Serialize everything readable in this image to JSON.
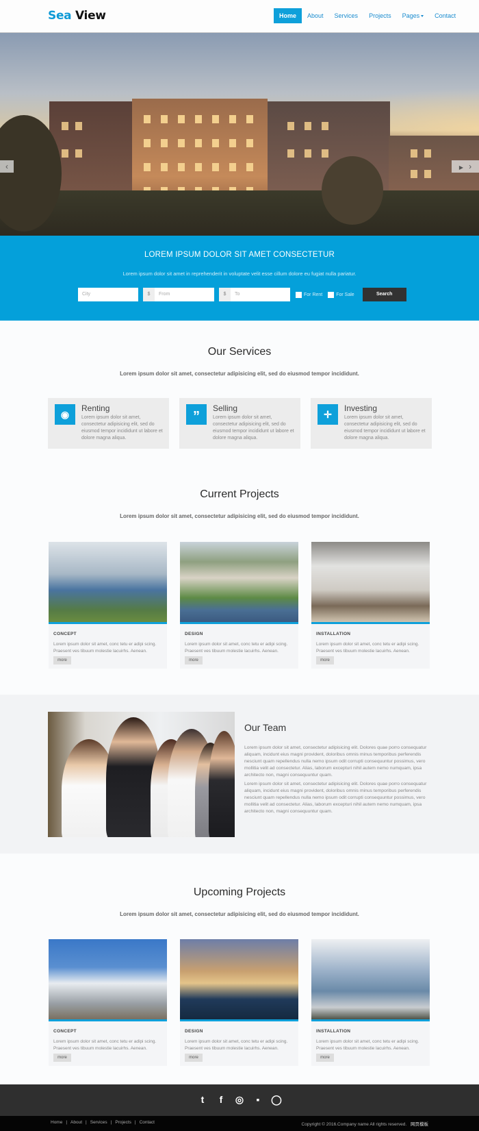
{
  "header": {
    "logo_part1": "Sea",
    "logo_part2": "View",
    "nav": [
      {
        "label": "Home",
        "active": true
      },
      {
        "label": "About"
      },
      {
        "label": "Services"
      },
      {
        "label": "Projects"
      },
      {
        "label": "Pages",
        "dropdown": true
      },
      {
        "label": "Contact"
      }
    ]
  },
  "hero": {
    "prev_icon": "chevron-left-icon",
    "next_icon": "chevron-right-icon",
    "play_icon": "play-icon",
    "prev_glyph": "‹",
    "next_glyph": "›",
    "play_glyph": "▶"
  },
  "search_band": {
    "title": "LOREM IPSUM DOLOR SIT AMET CONSECTETUR",
    "subtitle": "Lorem ipsum dolor sit amet in reprehenderit in voluptate velit esse cillum dolore eu fugiat nulla pariatur.",
    "city_placeholder": "City",
    "currency_symbol": "$",
    "from_placeholder": "From",
    "to_placeholder": "To",
    "for_rent_label": "For Rent",
    "for_sale_label": "For Sale",
    "search_button": "Search",
    "accent_color": "#04a0da"
  },
  "services": {
    "title": "Our Services",
    "subtitle": "Lorem ipsum dolor sit amet, consectetur adipisicing elit, sed do eiusmod tempor incididunt.",
    "items": [
      {
        "icon": "eye-icon",
        "glyph": "◉",
        "title": "Renting",
        "text": "Lorem ipsum dolor sit amet, consectetur adipisicing elit, sed do eiusmod tempor incididunt ut labore et dolore magna aliqua."
      },
      {
        "icon": "quote-icon",
        "glyph": "”",
        "title": "Selling",
        "text": "Lorem ipsum dolor sit amet, consectetur adipisicing elit, sed do eiusmod tempor incididunt ut labore et dolore magna aliqua."
      },
      {
        "icon": "move-arrows-icon",
        "glyph": "✛",
        "title": "Investing",
        "text": "Lorem ipsum dolor sit amet, consectetur adipisicing elit, sed do eiusmod tempor incididunt ut labore et dolore magna aliqua."
      }
    ]
  },
  "current_projects": {
    "title": "Current Projects",
    "subtitle": "Lorem ipsum dolor sit amet, consectetur adipisicing elit, sed do eiusmod tempor incididunt.",
    "items": [
      {
        "category": "CONCEPT",
        "text": "Lorem ipsum dolor sit amet, conc tetu er adipi scing. Praesent ves tibuum molestie lacuirhs. Aenean.",
        "button": "more",
        "image": "skyscrapers-photo"
      },
      {
        "category": "DESIGN",
        "text": "Lorem ipsum dolor sit amet, conc tetu er adipi scing. Praesent ves tibuum molestie lacuirhs. Aenean.",
        "button": "more",
        "image": "resort-photo"
      },
      {
        "category": "INSTALLATION",
        "text": "Lorem ipsum dolor sit amet, conc tetu er adipi scing. Praesent ves tibuum molestie lacuirhs. Aenean.",
        "button": "more",
        "image": "living-room-photo"
      }
    ]
  },
  "team": {
    "title": "Our Team",
    "paragraphs": [
      "Lorem ipsum dolor sit amet, consectetur adipisicing elit. Dolores quae porro consequatur aliquam, incidunt eius magni provident, doloribus omnis minus temporibus perferendis nesciunt quam repellendus nulla nemo ipsum odit corrupti consequuntur possimus, vero mollitia velit ad consectetur. Alias, laborum excepturi nihil autem nemo numquam, ipsa architecto non, magni consequuntur quam.",
      "Lorem ipsum dolor sit amet, consectetur adipisicing elit. Dolores quae porro consequatur aliquam, incidunt eius magni provident, doloribus omnis minus temporibus perferendis nesciunt quam repellendus nulla nemo ipsum odit corrupti consequuntur possimus, vero mollitia velit ad consectetur. Alias, laborum excepturi nihil autem nemo numquam, ipsa architecto non, magni consequuntur quam."
    ]
  },
  "upcoming_projects": {
    "title": "Upcoming Projects",
    "subtitle": "Lorem ipsum dolor sit amet, consectetur adipisicing elit, sed do eiusmod tempor incididunt.",
    "items": [
      {
        "category": "CONCEPT",
        "text": "Lorem ipsum dolor sit amet, conc tetu er adipi scing. Praesent ves tibuum molestie lacuirhs. Aenean.",
        "button": "more",
        "image": "modern-house-photo"
      },
      {
        "category": "DESIGN",
        "text": "Lorem ipsum dolor sit amet, conc tetu er adipi scing. Praesent ves tibuum molestie lacuirhs. Aenean.",
        "button": "more",
        "image": "pool-house-photo"
      },
      {
        "category": "INSTALLATION",
        "text": "Lorem ipsum dolor sit amet, conc tetu er adipi scing. Praesent ves tibuum molestie lacuirhs. Aenean.",
        "button": "more",
        "image": "office-tower-photo"
      }
    ]
  },
  "footer": {
    "socials": [
      {
        "name": "twitter-icon",
        "glyph": "t"
      },
      {
        "name": "facebook-icon",
        "glyph": "f"
      },
      {
        "name": "dribbble-icon",
        "glyph": "◎"
      },
      {
        "name": "flickr-icon",
        "glyph": "▪"
      },
      {
        "name": "github-icon",
        "glyph": "◯"
      }
    ],
    "links": [
      "Home",
      "About",
      "Services",
      "Projects",
      "Contact"
    ],
    "separator": "|",
    "copyright": "Copyright © 2016.Company name All rights reserved.",
    "copyright_extra": "网页模板"
  }
}
